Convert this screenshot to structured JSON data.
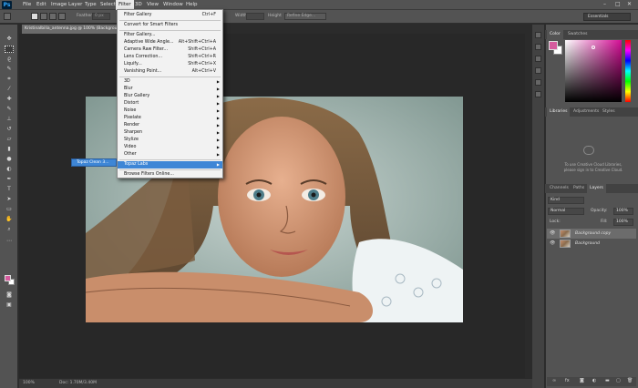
{
  "app": {
    "logo": "Ps",
    "menu": [
      "File",
      "Edit",
      "Image",
      "Layer",
      "Type",
      "Select",
      "Filter",
      "3D",
      "View",
      "Window",
      "Help"
    ],
    "active_menu": "Filter",
    "window_controls": [
      "–",
      "□",
      "✕"
    ]
  },
  "options_bar": {
    "feather_label": "Feather:",
    "feather_value": "0 px",
    "width_label": "Width",
    "height_label": "Height",
    "refine_edge": "Refine Edge...",
    "workspace": "Essentials"
  },
  "document": {
    "tab_title": "Kristinalbilia_antenna.jpg @ 100% (Background copy, RGB/8)",
    "zoom": "100%",
    "doc_info": "Doc: 1.70M/3.40M"
  },
  "filter_menu": {
    "items": [
      {
        "label": "Filter Gallery",
        "shortcut": "Ctrl+F"
      },
      {
        "sep": true
      },
      {
        "label": "Convert for Smart Filters"
      },
      {
        "sep": true
      },
      {
        "label": "Filter Gallery..."
      },
      {
        "label": "Adaptive Wide Angle...",
        "shortcut": "Alt+Shift+Ctrl+A"
      },
      {
        "label": "Camera Raw Filter...",
        "shortcut": "Shift+Ctrl+A"
      },
      {
        "label": "Lens Correction...",
        "shortcut": "Shift+Ctrl+R"
      },
      {
        "label": "Liquify...",
        "shortcut": "Shift+Ctrl+X"
      },
      {
        "label": "Vanishing Point...",
        "shortcut": "Alt+Ctrl+V"
      },
      {
        "sep": true
      },
      {
        "label": "3D",
        "submenu": true
      },
      {
        "label": "Blur",
        "submenu": true
      },
      {
        "label": "Blur Gallery",
        "submenu": true
      },
      {
        "label": "Distort",
        "submenu": true
      },
      {
        "label": "Noise",
        "submenu": true
      },
      {
        "label": "Pixelate",
        "submenu": true
      },
      {
        "label": "Render",
        "submenu": true
      },
      {
        "label": "Sharpen",
        "submenu": true
      },
      {
        "label": "Stylize",
        "submenu": true
      },
      {
        "label": "Video",
        "submenu": true
      },
      {
        "label": "Other",
        "submenu": true
      },
      {
        "sep": true
      },
      {
        "label": "Topaz Labs",
        "submenu": true,
        "highlighted": true
      },
      {
        "sep": true
      },
      {
        "label": "Browse Filters Online..."
      }
    ],
    "submenu_item": "Topaz Clean 3..."
  },
  "panels": {
    "color_tabs": [
      "Color",
      "Swatches"
    ],
    "library_tabs": [
      "Libraries",
      "Adjustments",
      "Styles"
    ],
    "cc_message_1": "To use Creative Cloud Libraries,",
    "cc_message_2": "please sign in to Creative Cloud.",
    "layers_tabs": [
      "Channels",
      "Paths",
      "Layers"
    ],
    "kind_filter": "Kind",
    "blend_mode": "Normal",
    "opacity_label": "Opacity:",
    "opacity_value": "100%",
    "lock_label": "Lock:",
    "fill_label": "Fill:",
    "fill_value": "100%",
    "layers": [
      {
        "name": "Background copy",
        "selected": true
      },
      {
        "name": "Background",
        "selected": false
      }
    ]
  },
  "colors": {
    "foreground": "#d55b9e",
    "background": "#ffffff",
    "highlight": "#3e86d6"
  }
}
